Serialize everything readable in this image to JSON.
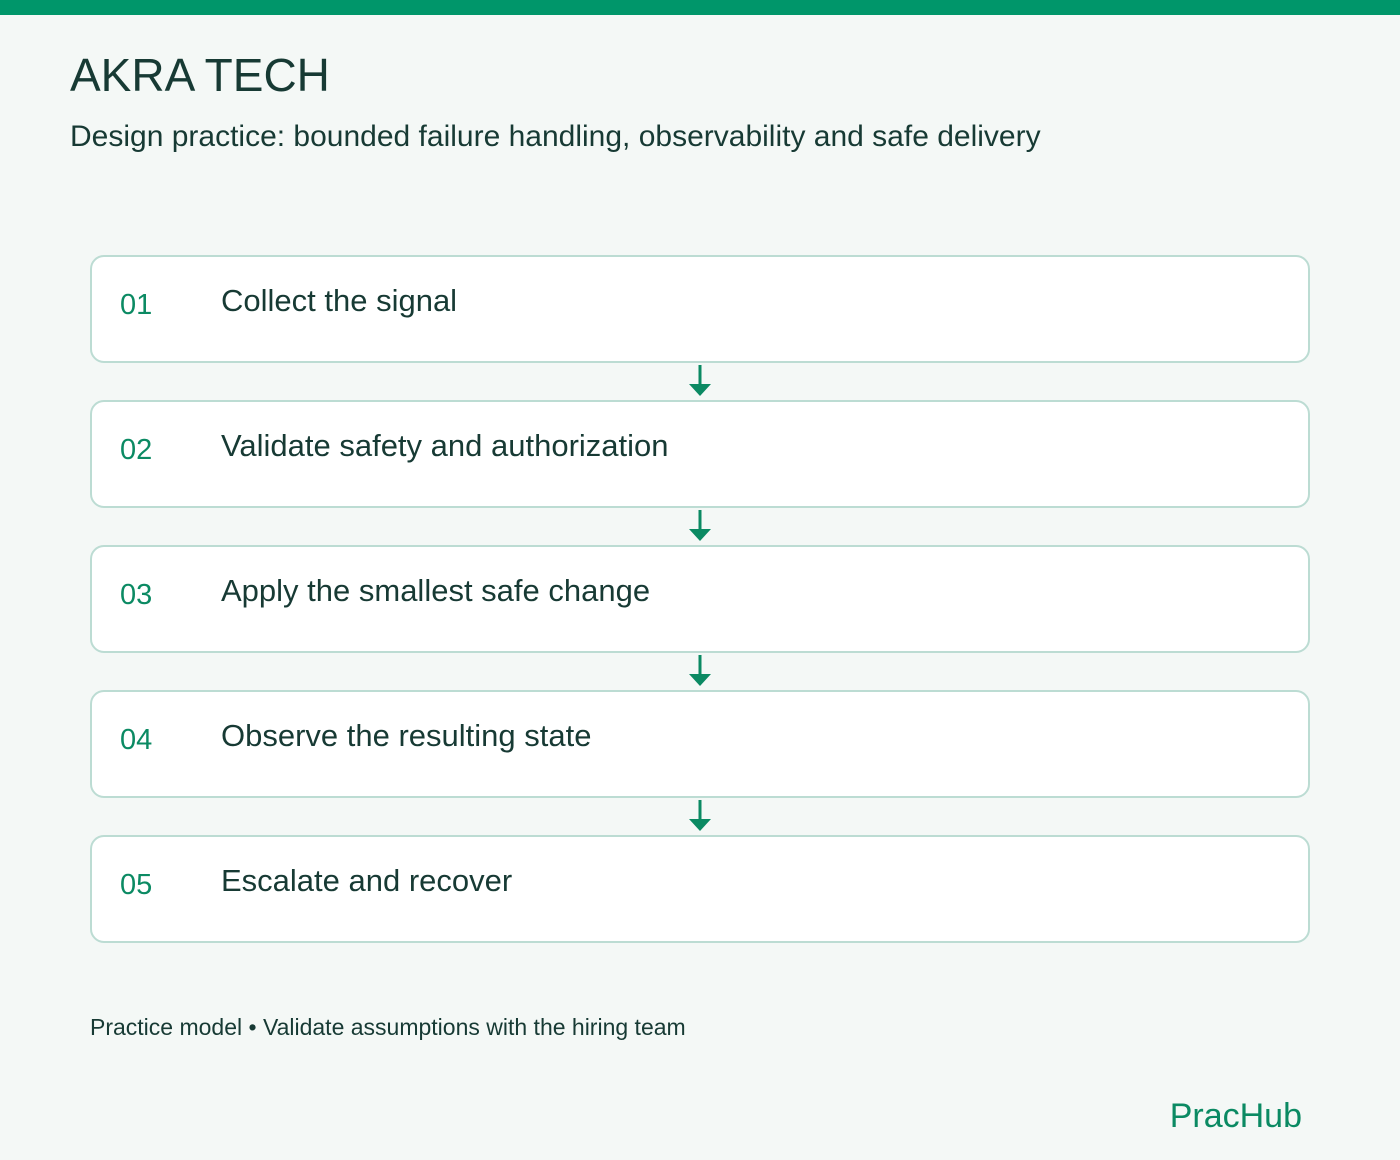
{
  "header": {
    "title": "AKRA TECH",
    "subtitle": "Design practice: bounded failure handling, observability and safe delivery"
  },
  "steps": [
    {
      "number": "01",
      "label": "Collect the signal"
    },
    {
      "number": "02",
      "label": "Validate safety and authorization"
    },
    {
      "number": "03",
      "label": "Apply the smallest safe change"
    },
    {
      "number": "04",
      "label": "Observe the resulting state"
    },
    {
      "number": "05",
      "label": "Escalate and recover"
    }
  ],
  "footer": {
    "note": "Practice model • Validate assumptions with the hiring team",
    "logo": "PracHub"
  },
  "colors": {
    "accent": "#00966a",
    "text": "#173a34",
    "card_border": "#bcdcd3",
    "background": "#f4f8f6"
  },
  "icons": {
    "connector": "arrow-down-icon"
  }
}
